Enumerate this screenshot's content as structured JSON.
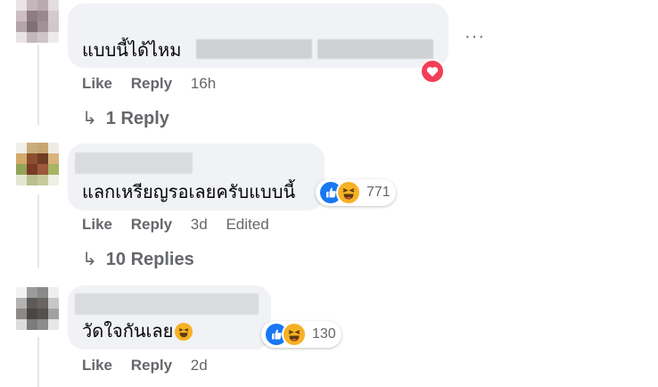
{
  "menu": {
    "more_label": "···"
  },
  "comments": [
    {
      "text": "แบบนี้ได้ไหม",
      "actions": {
        "like": "Like",
        "reply": "Reply",
        "time": "16h"
      },
      "replies": "1 Reply",
      "reaction": {
        "icons": [
          "heart-icon"
        ]
      }
    },
    {
      "text": "แลกเหรียญรอเลยครับแบบนี้",
      "actions": {
        "like": "Like",
        "reply": "Reply",
        "time": "3d",
        "edited": "Edited"
      },
      "replies": "10 Replies",
      "reaction": {
        "icons": [
          "like-icon",
          "haha-icon"
        ],
        "count": "771"
      }
    },
    {
      "text": "วัดใจกันเลย",
      "actions": {
        "like": "Like",
        "reply": "Reply",
        "time": "2d"
      },
      "reaction": {
        "icons": [
          "like-icon",
          "haha-icon"
        ],
        "count": "130"
      }
    }
  ],
  "colors": {
    "bubble": "#f0f2f5",
    "meta_text": "#65676b",
    "like_blue": "#1877f2",
    "haha_yellow": "#f7b125",
    "love_red": "#f33e58"
  }
}
